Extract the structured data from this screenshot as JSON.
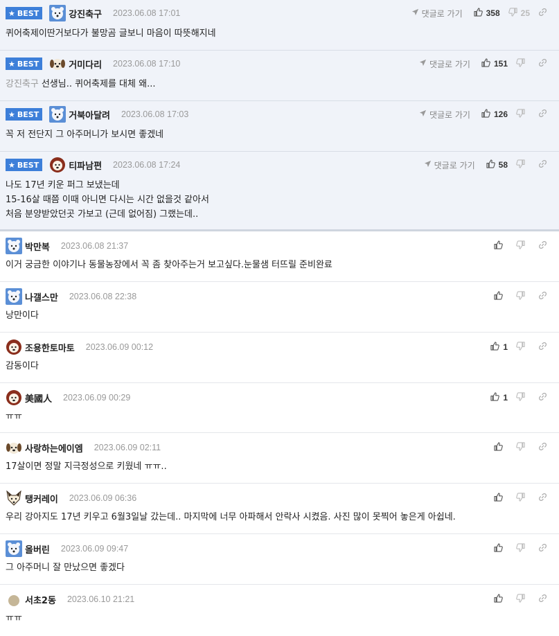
{
  "labels": {
    "best": "BEST",
    "goto": "댓글로 가기"
  },
  "colors": {
    "best_badge": "#3d7fd9",
    "best_bg": "#f0f3f9"
  },
  "comments": [
    {
      "best": true,
      "avatar": "polar-bear-icon",
      "nick": "강진축구",
      "date": "2023.06.08 17:01",
      "up": "358",
      "down": "25",
      "lines": [
        "퀴어축제이딴거보다가 불망곰 글보니 마음이 따뜻해지네"
      ]
    },
    {
      "best": true,
      "avatar": "puppy-icon",
      "nick": "거미다리",
      "date": "2023.06.08 17:10",
      "up": "151",
      "down": "",
      "mention": "강진축구",
      "lines": [
        "선생님.. 퀴어축제를 대체 왜..."
      ]
    },
    {
      "best": true,
      "avatar": "polar-bear-icon",
      "nick": "거북아달려",
      "date": "2023.06.08 17:03",
      "up": "126",
      "down": "",
      "lines": [
        "꼭 저 전단지 그 아주머니가 보시면 좋겠네"
      ]
    },
    {
      "best": true,
      "avatar": "lion-icon",
      "nick": "티파남편",
      "date": "2023.06.08 17:24",
      "up": "58",
      "down": "",
      "lines": [
        "나도 17년 키운 퍼그 보냈는데",
        "15-16살 때쯤 이때 아니면 다시는 시간 없을것 같아서",
        "처음 분양받았던곳 가보고 (근데 없어짐) 그랬는데.."
      ]
    },
    {
      "best": false,
      "avatar": "polar-bear-icon",
      "nick": "박만복",
      "date": "2023.06.08 21:37",
      "up": "",
      "down": "",
      "lines": [
        "이거 궁금한 이야기나 동물농장에서 꼭 좀 찾아주는거 보고싶다.눈물샘 터뜨릴 준비완료"
      ]
    },
    {
      "best": false,
      "avatar": "polar-bear-icon",
      "nick": "나갤스만",
      "date": "2023.06.08 22:38",
      "up": "",
      "down": "",
      "lines": [
        "낭만이다"
      ]
    },
    {
      "best": false,
      "avatar": "lion-icon",
      "nick": "조용한토마토",
      "date": "2023.06.09 00:12",
      "up": "1",
      "down": "",
      "lines": [
        "감동이다"
      ]
    },
    {
      "best": false,
      "avatar": "lion-icon",
      "nick": "美國人",
      "date": "2023.06.09 00:29",
      "up": "1",
      "down": "",
      "lines": [
        "ㅠㅠ"
      ]
    },
    {
      "best": false,
      "avatar": "puppy-icon",
      "nick": "사랑하는에이엠",
      "date": "2023.06.09 02:11",
      "up": "",
      "down": "",
      "lines": [
        "17살이면 정말 지극정성으로 키웠네 ㅠㅠ.."
      ]
    },
    {
      "best": false,
      "avatar": "fox-icon",
      "nick": "탱커레이",
      "date": "2023.06.09 06:36",
      "up": "",
      "down": "",
      "lines": [
        "우리 강아지도 17년 키우고 6월3일날 갔는데.. 마지막에 너무 아파해서 안락사 시켰음. 사진 많이 못찍어 놓은게 아쉽네."
      ]
    },
    {
      "best": false,
      "avatar": "polar-bear-icon",
      "nick": "올버린",
      "date": "2023.06.09 09:47",
      "up": "",
      "down": "",
      "lines": [
        "그 아주머니 잘 만났으면 좋겠다"
      ]
    },
    {
      "best": false,
      "avatar": "circle-avatar-icon",
      "nick": "서초2동",
      "date": "2023.06.10 21:21",
      "up": "",
      "down": "",
      "lines": [
        "ㅠㅠ"
      ]
    }
  ]
}
